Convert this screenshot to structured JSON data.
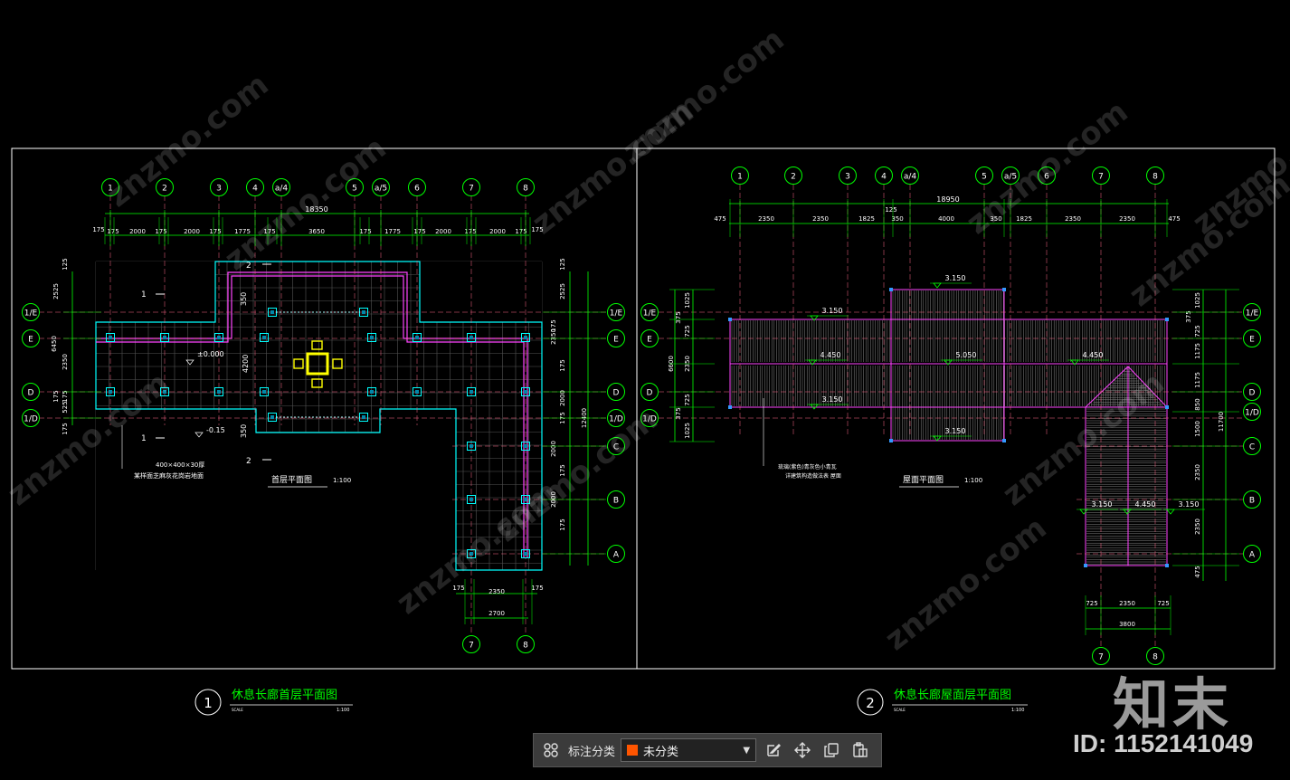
{
  "colors": {
    "frame": "#ffffff",
    "grid_axis": "#00ff00",
    "dimension": "#00ff00",
    "wall": "#00ffff",
    "roof": "#ff44ff",
    "column": "#00ffff",
    "hatch": "#ffffff",
    "text": "#ffffff",
    "title": "#00ff00",
    "accent": "#ffff00",
    "swatch": "#ff5500"
  },
  "plan1": {
    "axis_top": [
      "1",
      "2",
      "3",
      "4",
      "a/4",
      "5",
      "a/5",
      "6",
      "7",
      "8"
    ],
    "axis_left": [
      "1/E",
      "E",
      "D",
      "1/D"
    ],
    "axis_right": [
      "1/E",
      "E",
      "D",
      "1/D",
      "C",
      "B",
      "A"
    ],
    "axis_bottom": [
      "7",
      "8"
    ],
    "total_dim": "18350",
    "dims_row": [
      "175",
      "175",
      "2000",
      "175",
      "2000",
      "175",
      "1775",
      "175",
      "3650",
      "175",
      "1775",
      "175",
      "2000",
      "175",
      "2000",
      "175",
      "175"
    ],
    "left_dims": [
      "125",
      "2525",
      "6450",
      "175",
      "2350",
      "175",
      "525",
      "175"
    ],
    "right_dims": [
      "125",
      "2525",
      "175",
      "2350",
      "175",
      "2000",
      "175",
      "2000",
      "175",
      "2000",
      "175",
      "12400"
    ],
    "bottom_dims": [
      "175",
      "2350",
      "175",
      "2700"
    ],
    "elevation_1": "±0.000",
    "elevation_2": "-0.15",
    "dim_4200": "4200",
    "dim_350": "350",
    "note_line1": "400×400×30厚",
    "note_line2": "某样面芝麻灰花岗岩地面",
    "section_1": "1",
    "section_2": "2",
    "sub_title": "首层平面图",
    "sub_scale": "1:100",
    "title_no": "1",
    "title": "休息长廊首层平面图",
    "scale_word": "SCALE",
    "scale": "1:100"
  },
  "plan2": {
    "axis_top": [
      "1",
      "2",
      "3",
      "4",
      "a/4",
      "5",
      "a/5",
      "6",
      "7",
      "8"
    ],
    "axis_left": [
      "1/E",
      "E",
      "D",
      "1/D"
    ],
    "axis_right": [
      "1/E",
      "E",
      "D",
      "1/D",
      "C",
      "B",
      "A"
    ],
    "axis_bottom": [
      "7",
      "8"
    ],
    "total_dim": "18950",
    "dims_row": [
      "475",
      "2350",
      "2350",
      "1825",
      "125",
      "350",
      "4000",
      "350",
      "1825",
      "2350",
      "2350",
      "475"
    ],
    "left_dims": [
      "375",
      "1025",
      "725",
      "6600",
      "2350",
      "725",
      "375",
      "1025"
    ],
    "right_dims": [
      "375",
      "1025",
      "725",
      "1175",
      "1175",
      "850",
      "1500",
      "2350",
      "2350",
      "475",
      "11700"
    ],
    "bottom_dims": [
      "725",
      "2350",
      "725",
      "3800"
    ],
    "elevations": [
      "3.150",
      "3.150",
      "4.450",
      "5.050",
      "4.450",
      "3.150",
      "3.150",
      "3.150",
      "4.450",
      "3.150"
    ],
    "note_line1": "琉璃(紫色)青灰色小青瓦",
    "note_line2": "详建筑构造做法表 屋面",
    "sub_title": "屋面平面图",
    "sub_scale": "1:100",
    "title_no": "2",
    "title": "休息长廊屋面层平面图",
    "scale_word": "SCALE",
    "scale": "1:100"
  },
  "toolbar": {
    "label": "标注分类",
    "select_value": "未分类"
  },
  "watermark": {
    "brand": "知末",
    "id": "ID: 1152141049",
    "diagonal": "znzmo.com"
  }
}
